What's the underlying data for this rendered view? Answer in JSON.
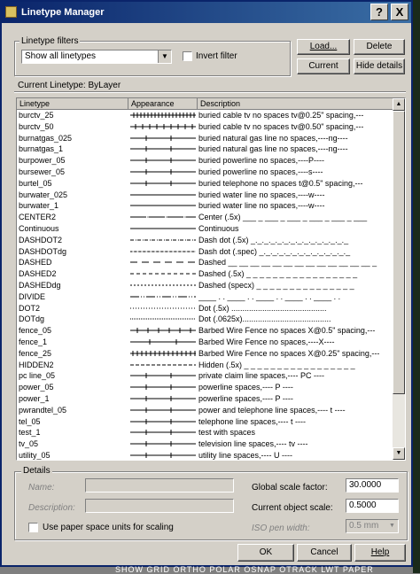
{
  "window": {
    "title": "Linetype Manager",
    "help_glyph": "?",
    "close_glyph": "X"
  },
  "filters": {
    "group_label": "Linetype filters",
    "selected": "Show all linetypes",
    "invert_label": "Invert filter",
    "invert_checked": false
  },
  "buttons": {
    "load": "Load...",
    "delete": "Delete",
    "current": "Current",
    "hide_details": "Hide details",
    "ok": "OK",
    "cancel": "Cancel",
    "help": "Help"
  },
  "current_linetype": "Current Linetype:  ByLayer",
  "table": {
    "headers": [
      "Linetype",
      "Appearance",
      "Description"
    ],
    "rows": [
      {
        "name": "burctv_25",
        "pattern": "cabletv",
        "desc": "buried cable tv no spaces tv@0.25\" spacing,---"
      },
      {
        "name": "burctv_50",
        "pattern": "cabletv50",
        "desc": "buried cable tv no spaces tv@0.50\" spacing,---"
      },
      {
        "name": "burnatgas_025",
        "pattern": "dashtick",
        "desc": "buried natural gas line no spaces,----ng----"
      },
      {
        "name": "burnatgas_1",
        "pattern": "dashtick",
        "desc": "buried natural gas line no spaces,----ng----"
      },
      {
        "name": "burpower_05",
        "pattern": "dashtick",
        "desc": "buried powerline no spaces,----P----"
      },
      {
        "name": "bursewer_05",
        "pattern": "dashtick",
        "desc": "buried powerline no spaces,----s----"
      },
      {
        "name": "burtel_05",
        "pattern": "dashtick",
        "desc": "buried telephone no spaces t@0.5\" spacing,---"
      },
      {
        "name": "burwater_025",
        "pattern": "continuous",
        "desc": "buried water line no spaces,----w----"
      },
      {
        "name": "burwater_1",
        "pattern": "continuous",
        "desc": "buried water line no spaces,----w----"
      },
      {
        "name": "CENTER2",
        "pattern": "center",
        "desc": "Center (.5x) ___ _ ___ _ ___ _ ___ _ ___ _ ___"
      },
      {
        "name": "Continuous",
        "pattern": "continuous",
        "desc": "Continuous"
      },
      {
        "name": "DASHDOT2",
        "pattern": "dashdot",
        "desc": "Dash dot (.5x) _._._._._._._._._._._._._._._"
      },
      {
        "name": "DASHDOTdg",
        "pattern": "dashdotfine",
        "desc": "Dash dot (.spec) _._._._._._._._._._._._._._"
      },
      {
        "name": "DASHED",
        "pattern": "dashed",
        "desc": "Dashed __ __ __ __ __ __ __ __ __ __ __ __ __ _"
      },
      {
        "name": "DASHED2",
        "pattern": "dashed2",
        "desc": "Dashed (.5x) _ _ _ _ _ _ _ _ _ _ _ _ _ _ _ _ _"
      },
      {
        "name": "DASHEDdg",
        "pattern": "dashedfine",
        "desc": "Dashed (specx) _ _ _ _ _ _ _ _ _ _ _ _ _ _ _"
      },
      {
        "name": "DIVIDE",
        "pattern": "divide",
        "desc": "____ . . ____ . . ____ . . ____ . . ____ . ."
      },
      {
        "name": "DOT2",
        "pattern": "dot",
        "desc": "Dot (.5x) ..........................................."
      },
      {
        "name": "DOTdg",
        "pattern": "dotfine",
        "desc": "Dot (.0625x)........................................"
      },
      {
        "name": "fence_05",
        "pattern": "fencex",
        "desc": "Barbed Wire Fence no spaces X@0.5\" spacing,---"
      },
      {
        "name": "fence_1",
        "pattern": "fencex1",
        "desc": "Barbed Wire Fence no spaces,----X----"
      },
      {
        "name": "fence_25",
        "pattern": "fencedense",
        "desc": "Barbed Wire Fence no spaces X@0.25\" spacing,---"
      },
      {
        "name": "HIDDEN2",
        "pattern": "hidden",
        "desc": "Hidden (.5x) _ _ _ _ _ _ _ _ _ _ _ _ _ _ _ _ _"
      },
      {
        "name": "pc line_05",
        "pattern": "dashtick",
        "desc": "private claim line spaces,---- PC ----"
      },
      {
        "name": "power_05",
        "pattern": "dashtick",
        "desc": "powerline spaces,---- P ----"
      },
      {
        "name": "power_1",
        "pattern": "dashtick",
        "desc": "powerline spaces,---- P ----"
      },
      {
        "name": "pwrandtel_05",
        "pattern": "dashtick",
        "desc": "power and telephone line spaces,---- t ----"
      },
      {
        "name": "tel_05",
        "pattern": "dashtick",
        "desc": "telephone line spaces,---- t ----"
      },
      {
        "name": "test_1",
        "pattern": "dashtick",
        "desc": "test with spaces"
      },
      {
        "name": "tv_05",
        "pattern": "dashtick",
        "desc": "television line spaces,---- tv ----"
      },
      {
        "name": "utility_05",
        "pattern": "dashtick",
        "desc": "utility line spaces,---- U ----"
      }
    ]
  },
  "details": {
    "group_label": "Details",
    "name_label": "Name:",
    "description_label": "Description:",
    "paper_space_label": "Use paper space units for scaling",
    "paper_space_checked": false,
    "global_scale_label": "Global scale factor:",
    "global_scale_value": "30.0000",
    "object_scale_label": "Current object scale:",
    "object_scale_value": "0.5000",
    "iso_pen_label": "ISO pen width:",
    "iso_pen_value": "0.5 mm"
  },
  "status_strip": "SHOW  GRID  ORTHO  POLAR  OSNAP  OTRACK  LWT  PAPER"
}
